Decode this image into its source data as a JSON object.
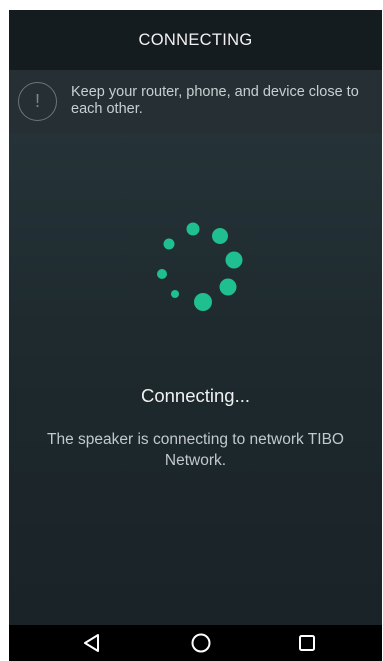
{
  "header": {
    "title": "CONNECTING"
  },
  "notice": {
    "icon": "alert-circle-icon",
    "text": "Keep your router, phone, and device close to each other."
  },
  "status": {
    "title": "Connecting...",
    "description": "The speaker is connecting to network TIBO Network."
  },
  "colors": {
    "accent": "#1fbf8f",
    "header_bg": "#151c1f",
    "notice_bg": "#263034",
    "background": "#1b2428",
    "navbar_bg": "#000000"
  },
  "navbar": {
    "buttons": [
      "back-icon",
      "home-icon",
      "recents-icon"
    ]
  }
}
